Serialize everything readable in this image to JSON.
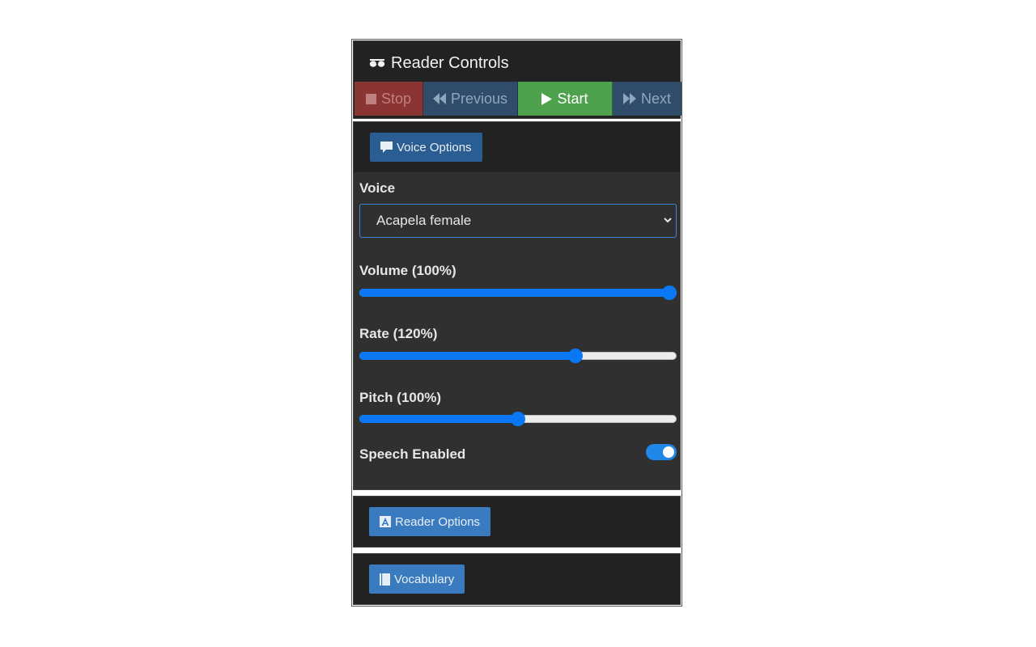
{
  "header": {
    "title": "Reader Controls"
  },
  "toolbar": {
    "stop_label": "Stop",
    "previous_label": "Previous",
    "start_label": "Start",
    "next_label": "Next"
  },
  "voice_options": {
    "button_label": "Voice Options",
    "voice_label": "Voice",
    "voice_selected": "Acapela female",
    "volume_label": "Volume (100%)",
    "volume_value": 100,
    "rate_label": "Rate (120%)",
    "rate_fraction": 0.69,
    "pitch_label": "Pitch (100%)",
    "pitch_fraction": 0.5,
    "speech_label": "Speech Enabled",
    "speech_enabled": true
  },
  "reader_options": {
    "button_label": "Reader Options"
  },
  "vocabulary": {
    "button_label": "Vocabulary"
  },
  "colors": {
    "accent": "#0a78f5",
    "start_green": "#4ea24e",
    "stop_red": "#8a3434",
    "nav_blue": "#2f4d6b"
  },
  "icons": [
    "glasses-icon",
    "stop-icon",
    "backward-icon",
    "play-icon",
    "forward-icon",
    "comment-icon",
    "font-icon",
    "book-icon",
    "chevron-down-icon"
  ]
}
